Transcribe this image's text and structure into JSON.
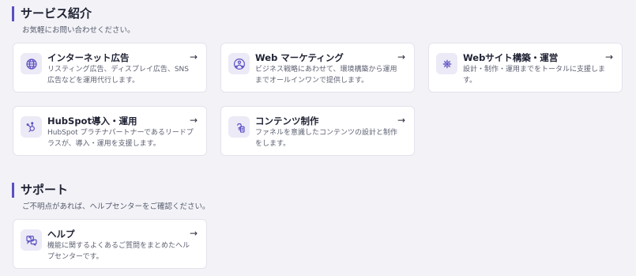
{
  "services": {
    "title": "サービス紹介",
    "subtitle": "お気軽にお問い合わせください。",
    "cards": [
      {
        "icon": "globe-icon",
        "title": "インターネット広告",
        "desc": "リスティング広告、ディスプレイ広告、SNS広告などを運用代行します。",
        "arrow": "→"
      },
      {
        "icon": "network-people-icon",
        "title": "Web マーケティング",
        "desc": "ビジネス戦略にあわせて、環境構築から運用までオールインワンで提供します。",
        "arrow": "→"
      },
      {
        "icon": "website-gear-icon",
        "title": "Webサイト構築・運営",
        "desc": "設計・制作・運用までをトータルに支援します。",
        "arrow": "→"
      },
      {
        "icon": "hubspot-icon",
        "title": "HubSpot導入・運用",
        "desc": "HubSpot プラチナパートナーであるリードプラスが、導入・運用を支援します。",
        "arrow": "→"
      },
      {
        "icon": "content-document-icon",
        "title": "コンテンツ制作",
        "desc": "ファネルを意識したコンテンツの設計と制作をします。",
        "arrow": "→"
      }
    ]
  },
  "support": {
    "title": "サポート",
    "subtitle": "ご不明点があれば、ヘルプセンターをご確認ください。",
    "cards": [
      {
        "icon": "help-chat-icon",
        "title": "ヘルプ",
        "desc": "機能に関するよくあるご質問をまとめたヘルプセンターです。",
        "arrow": "→"
      }
    ]
  },
  "colors": {
    "accent": "#5b4fc4",
    "icon_bg": "#ebeaf6",
    "page_bg": "#f2f2f7"
  }
}
